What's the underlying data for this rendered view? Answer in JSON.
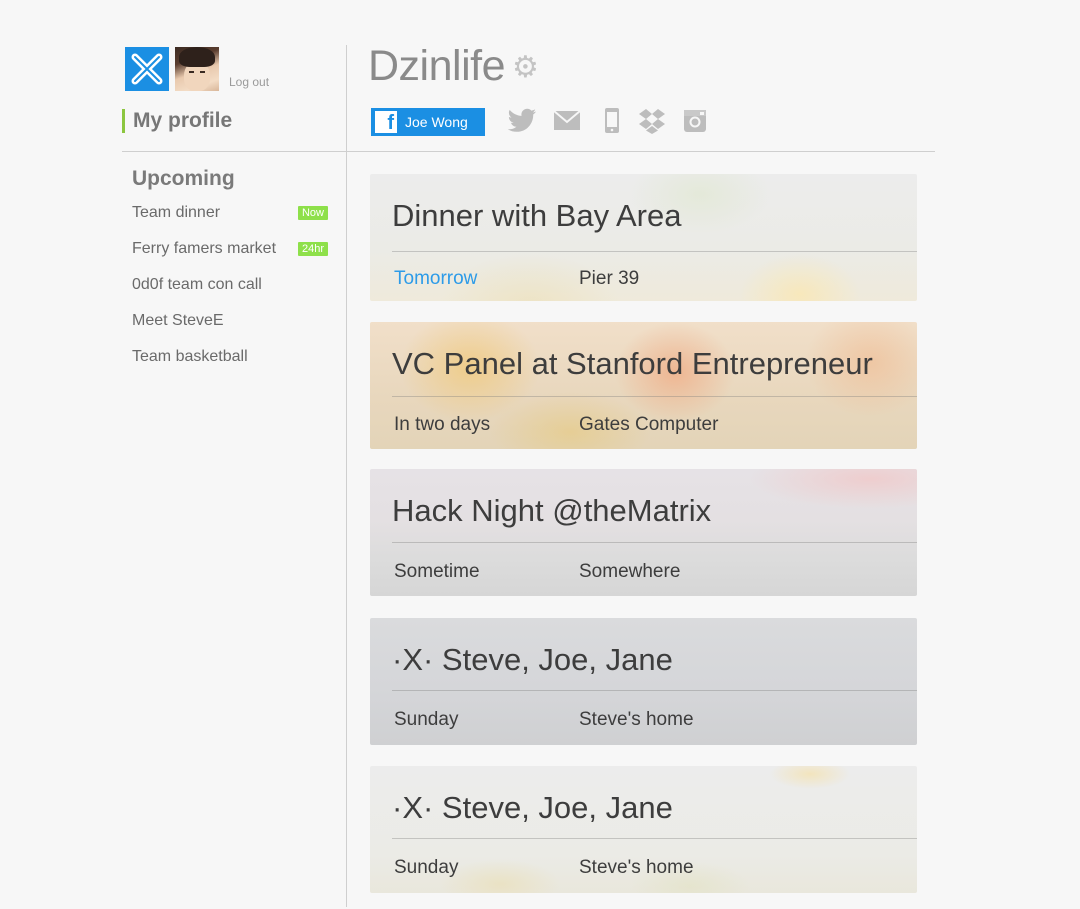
{
  "user": {
    "logout_label": "Log out"
  },
  "sidebar": {
    "profile_label": "My profile",
    "upcoming_heading": "Upcoming",
    "items": [
      {
        "label": "Team dinner",
        "badge": "Now"
      },
      {
        "label": "Ferry famers market",
        "badge": "24hr"
      },
      {
        "label": "0d0f team con call",
        "badge": ""
      },
      {
        "label": "Meet SteveE",
        "badge": ""
      },
      {
        "label": "Team basketball",
        "badge": ""
      }
    ]
  },
  "header": {
    "title": "Dzinlife",
    "facebook_name": "Joe Wong",
    "social_icons": [
      "twitter-icon",
      "mail-icon",
      "phone-icon",
      "dropbox-icon",
      "instagram-icon"
    ]
  },
  "events": [
    {
      "title": "Dinner with Bay Area",
      "when": "Tomorrow",
      "where": "Pier 39"
    },
    {
      "title": "VC Panel at Stanford Entrepreneur",
      "when": "In two days",
      "where": "Gates Computer"
    },
    {
      "title": "Hack Night @theMatrix",
      "when": "Sometime",
      "where": "Somewhere"
    },
    {
      "title": "·X· Steve, Joe, Jane",
      "when": "Sunday",
      "where": "Steve's home"
    },
    {
      "title": "·X· Steve, Joe, Jane",
      "when": "Sunday",
      "where": "Steve's home"
    }
  ],
  "colors": {
    "accent_blue": "#1b8fe3",
    "badge_green": "#8ee04a",
    "profile_marker": "#8cc63f",
    "link_blue": "#2d9be8"
  }
}
